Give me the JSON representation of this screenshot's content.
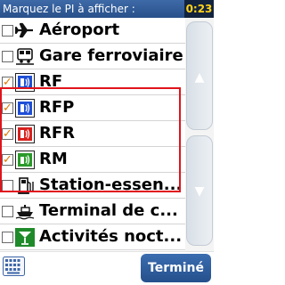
{
  "header": {
    "title": "Marquez le PI à afficher :",
    "time": "0:23"
  },
  "items": [
    {
      "label": "Aéroport",
      "checked": false,
      "icon": "airplane-icon"
    },
    {
      "label": "Gare ferroviaire",
      "checked": false,
      "icon": "train-icon"
    },
    {
      "label": "RF",
      "checked": true,
      "icon": "poi-rf-icon",
      "icon_color": "#1f4fd6"
    },
    {
      "label": "RFP",
      "checked": true,
      "icon": "poi-rfp-icon",
      "icon_color": "#1f4fd6"
    },
    {
      "label": "RFR",
      "checked": true,
      "icon": "poi-rfr-icon",
      "icon_color": "#d8201c"
    },
    {
      "label": "RM",
      "checked": true,
      "icon": "poi-rm-icon",
      "icon_color": "#2a9a2a"
    },
    {
      "label": "Station-essen...",
      "checked": false,
      "icon": "fuel-pump-icon"
    },
    {
      "label": "Terminal de c...",
      "checked": false,
      "icon": "ship-icon"
    },
    {
      "label": "Activités noct...",
      "checked": false,
      "icon": "cocktail-icon"
    }
  ],
  "checkmark": "✓",
  "scroll": {
    "up_arrow": "▲",
    "down_arrow": "▼"
  },
  "footer": {
    "done_label": "Terminé"
  },
  "colors": {
    "selection": "#e0141c",
    "check": "#e07800",
    "header": "#2f5b99",
    "time_text": "#ffd21a"
  }
}
